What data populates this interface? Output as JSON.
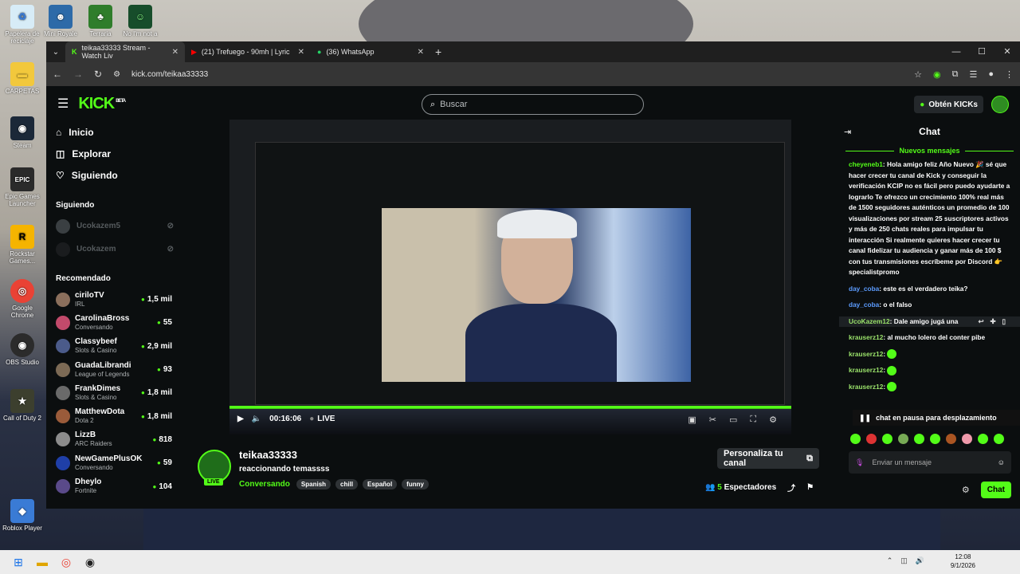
{
  "desktop": {
    "icons": [
      {
        "label": "Papelera de reciclaje",
        "glyph": "♻",
        "color": "#d7ecf7"
      },
      {
        "label": "Mini Royale",
        "glyph": "☻",
        "color": "#2d6aa8"
      },
      {
        "label": "Terraria",
        "glyph": "♣",
        "color": "#2f7d2b"
      },
      {
        "label": "No I'm not a",
        "glyph": "☺",
        "color": "#174d2b"
      },
      {
        "label": "CARPETAS",
        "glyph": "▬",
        "color": "#f2c83c"
      },
      {
        "label": "Steam",
        "glyph": "◉",
        "color": "#1b2838"
      },
      {
        "label": "Epic Games Launcher",
        "glyph": "EPIC",
        "color": "#2a2a2a"
      },
      {
        "label": "Rockstar Games...",
        "glyph": "R",
        "color": "#f5b400"
      },
      {
        "label": "Google Chrome",
        "glyph": "◎",
        "color": "#e94235"
      },
      {
        "label": "OBS Studio",
        "glyph": "◉",
        "color": "#2b2b2b"
      },
      {
        "label": "Call of Duty 2",
        "glyph": "★",
        "color": "#3c3f2e"
      },
      {
        "label": "Roblox Player",
        "glyph": "◆",
        "color": "#3a7bd5"
      }
    ]
  },
  "browser": {
    "tabs": [
      {
        "title": "teikaa33333 Stream - Watch Liv",
        "close": "✕"
      },
      {
        "title": "(21) Trefuego - 90mh | Lyric",
        "close": "✕"
      },
      {
        "title": "(36) WhatsApp",
        "close": "✕"
      }
    ],
    "new_tab": "+",
    "url": "kick.com/teikaa33333",
    "url_prefix": "kick.com/",
    "window": {
      "min": "—",
      "max": "☐",
      "close": "✕"
    }
  },
  "kick": {
    "logo": "KICK",
    "logo_sup": "BETA",
    "search_placeholder": "Buscar",
    "kicks_button": "Obtén KICKs",
    "nav": [
      {
        "icon": "⌂",
        "label": "Inicio"
      },
      {
        "icon": "◫",
        "label": "Explorar"
      },
      {
        "icon": "♡",
        "label": "Siguiendo"
      }
    ],
    "following_title": "Siguiendo",
    "following": [
      {
        "name": "Ucokazem5"
      },
      {
        "name": "Ucokazem"
      }
    ],
    "recommended_title": "Recomendado",
    "recommended": [
      {
        "name": "ciriloTV",
        "cat": "IRL",
        "viewers": "1,5 mil",
        "color": "#8b6f5c"
      },
      {
        "name": "CarolinaBross",
        "cat": "Conversando",
        "viewers": "55",
        "color": "#c24a6b"
      },
      {
        "name": "Classybeef",
        "cat": "Slots & Casino",
        "viewers": "2,9 mil",
        "color": "#4b5b8a"
      },
      {
        "name": "GuadaLibrandi",
        "cat": "League of Legends",
        "viewers": "93",
        "color": "#7c6a55"
      },
      {
        "name": "FrankDimes",
        "cat": "Slots & Casino",
        "viewers": "1,8 mil",
        "color": "#6a6a6a"
      },
      {
        "name": "MatthewDota",
        "cat": "Dota 2",
        "viewers": "1,8 mil",
        "color": "#9a5b3a"
      },
      {
        "name": "LizzB",
        "cat": "ARC Raiders",
        "viewers": "818",
        "color": "#8c8c8c"
      },
      {
        "name": "NewGamePlusOK",
        "cat": "Conversando",
        "viewers": "59",
        "color": "#1f3fa8"
      },
      {
        "name": "Dheylo",
        "cat": "Fortnite",
        "viewers": "104",
        "color": "#5a4a8a"
      }
    ],
    "player": {
      "time": "00:16:06",
      "live": "LIVE"
    },
    "stream": {
      "name": "teikaa33333",
      "title": "reaccionando temassss",
      "category": "Conversando",
      "tags": [
        "Spanish",
        "chill",
        "Español",
        "funny"
      ],
      "live_badge": "LIVE",
      "personalize": "Personaliza tu canal",
      "viewers": "5",
      "viewers_label": "Espectadores"
    },
    "chat": {
      "title": "Chat",
      "new_messages": "Nuevos mensajes",
      "messages": [
        {
          "user": "cheyeneb1",
          "text": "Hola amigo feliz Año Nuevo 🎉 sé que hacer crecer tu canal de Kick y conseguir la verificación KCIP no es fácil pero puedo ayudarte a lograrlo Te ofrezco un crecimiento 100% real más de 1500 seguidores auténticos un promedio de 100 visualizaciones por stream 25 suscriptores activos y más de 250 chats reales para impulsar tu interacción Si realmente quieres hacer crecer tu canal fidelizar tu audiencia y ganar más de 100 $ con tus transmisiones escríbeme por Discord 👉 specialistpromo"
        },
        {
          "user": "day_coba",
          "text": "este es el verdadero teika?"
        },
        {
          "user": "day_coba",
          "text": "o el falso"
        },
        {
          "user": "UcoKazem12",
          "text": "Dale amigo jugá una"
        },
        {
          "user": "krauserz12",
          "text": "al mucho lolero del conter pibe"
        },
        {
          "user": "krauserz12",
          "text": ""
        },
        {
          "user": "krauserz12",
          "text": ""
        },
        {
          "user": "krauserz12",
          "text": ""
        }
      ],
      "paused": "chat en pausa para desplazamiento",
      "input_placeholder": "Enviar un mensaje",
      "send": "Chat"
    }
  },
  "taskbar": {
    "time": "12:08",
    "date": "9/1/2026"
  }
}
